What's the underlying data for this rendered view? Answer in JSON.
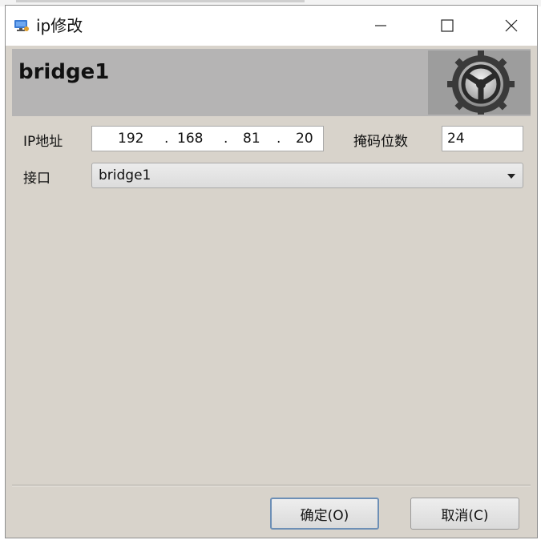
{
  "window": {
    "title": "ip修改"
  },
  "header": {
    "title": "bridge1",
    "icon": "gear-icon"
  },
  "form": {
    "ip_label": "IP地址",
    "ip_octets": [
      "192",
      "168",
      "81",
      "20"
    ],
    "ip_separator": ".",
    "mask_label": "掩码位数",
    "mask_value": "24",
    "interface_label": "接口",
    "interface_value": "bridge1"
  },
  "buttons": {
    "ok_label": "确定(O)",
    "cancel_label": "取消(C)"
  },
  "colors": {
    "window_bg": "#d8d3cb",
    "banner_bg": "#b5b4b4",
    "ok_border": "#6d8fb6"
  }
}
